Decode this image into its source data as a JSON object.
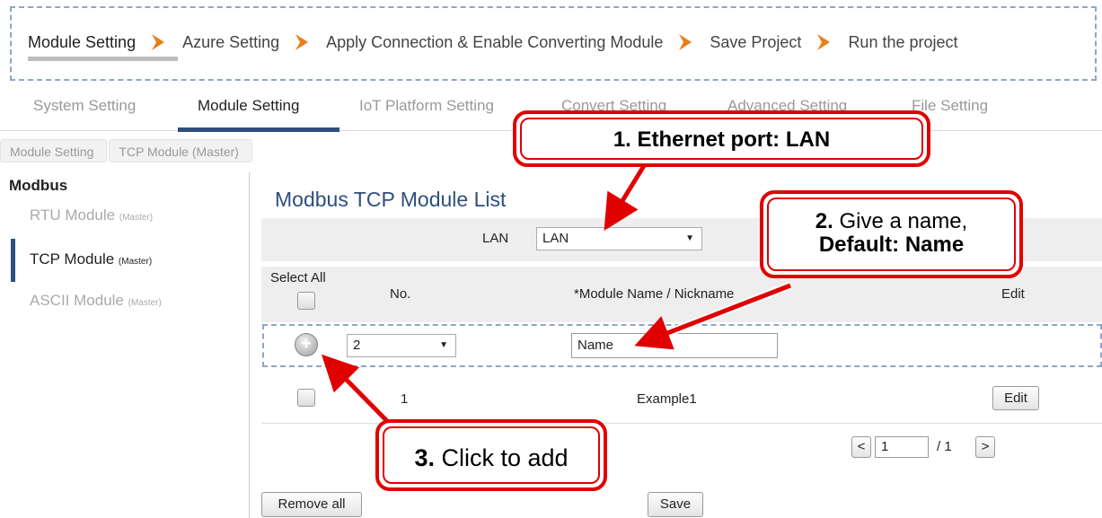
{
  "wizard": {
    "steps": [
      "Module Setting",
      "Azure Setting",
      "Apply Connection & Enable Converting Module",
      "Save Project",
      "Run the project"
    ]
  },
  "tabs": [
    "System Setting",
    "Module Setting",
    "IoT Platform Setting",
    "Convert Setting",
    "Advanced Setting",
    "File Setting"
  ],
  "breadcrumb": [
    "Module Setting",
    "TCP Module (Master)"
  ],
  "sidebar": {
    "title": "Modbus",
    "items": [
      {
        "label": "RTU Module",
        "suffix": "(Master)"
      },
      {
        "label": "TCP Module",
        "suffix": "(Master)"
      },
      {
        "label": "ASCII Module",
        "suffix": "(Master)"
      }
    ]
  },
  "main": {
    "title": "Modbus TCP Module List",
    "lan_label": "LAN",
    "lan_value": "LAN",
    "headers": {
      "select_all": "Select All",
      "no": "No.",
      "name": "*Module Name / Nickname",
      "edit": "Edit"
    },
    "add_row": {
      "no_value": "2",
      "name_value": "Name"
    },
    "rows": [
      {
        "no": "1",
        "name": "Example1",
        "edit": "Edit"
      }
    ],
    "pager": {
      "prev": "<",
      "page": "1",
      "total": "/ 1",
      "next": ">"
    },
    "remove_all": "Remove all",
    "save": "Save"
  },
  "callouts": {
    "one": {
      "num": "1.",
      "text": "Ethernet port: LAN"
    },
    "two": {
      "num": "2.",
      "text": "Give a name,",
      "bold": "Default: Name"
    },
    "three": {
      "num": "3.",
      "text": "Click to add"
    }
  },
  "colors": {
    "accent": "#2d4f7f",
    "callout": "#e00000",
    "chevron": "#e87f1a"
  }
}
